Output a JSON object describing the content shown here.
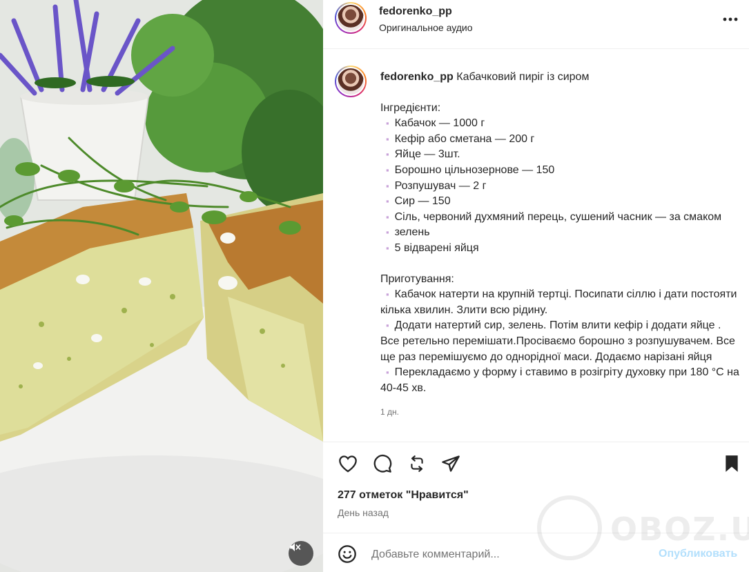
{
  "header": {
    "username": "fedorenko_pp",
    "audio": "Оригинальное аудио"
  },
  "caption": {
    "username": "fedorenko_pp",
    "title": "Кабачковий пиріг із сиром",
    "ingredients_heading": "Інгредієнти:",
    "bullet": "▪︎",
    "ingredients": [
      "Кабачок — 1000 г",
      "Кефір або сметана — 200 г",
      "Яйце — 3шт.",
      "Борошно цільнозернове — 150",
      "Розпушувач — 2 г",
      "Сир — 150",
      "Сіль, червоний духмяний перець, сушений часник — за смаком",
      "зелень",
      "5 відварені яйця"
    ],
    "steps_heading": "Приготування:",
    "steps": [
      "Кабачок натерти на крупній тертці. Посипати сіллю і дати постояти кілька хвилин. Злити всю рідину.",
      "Додати натертий сир, зелень. Потім влити кефір і додати яйце . Все ретельно перемішати.Просіваємо борошно з розпушувачем. Все ще раз перемішуємо до однорідної маси. Додаємо нарізані яйця",
      "Перекладаємо у форму і ставимо в розігріту духовку при 180 °С на 40-45 хв."
    ],
    "time": "1 дн."
  },
  "engagement": {
    "likes": "277 отметок \"Нравится\"",
    "posted": "День назад"
  },
  "comment": {
    "placeholder": "Добавьте комментарий...",
    "publish_label": "Опубликовать"
  },
  "watermark": {
    "text": "OBOZ.UA"
  },
  "icons": {
    "more": "more-horizontal-icon",
    "like": "heart-icon",
    "comment": "comment-icon",
    "repost": "repost-icon",
    "share": "send-icon",
    "save": "bookmark-icon",
    "emoji": "emoji-icon",
    "mute": "muted-speaker-icon"
  },
  "colors": {
    "publish_disabled": "#b2dffc",
    "bullet": "#c9a3d9",
    "secondary_text": "#737373"
  }
}
